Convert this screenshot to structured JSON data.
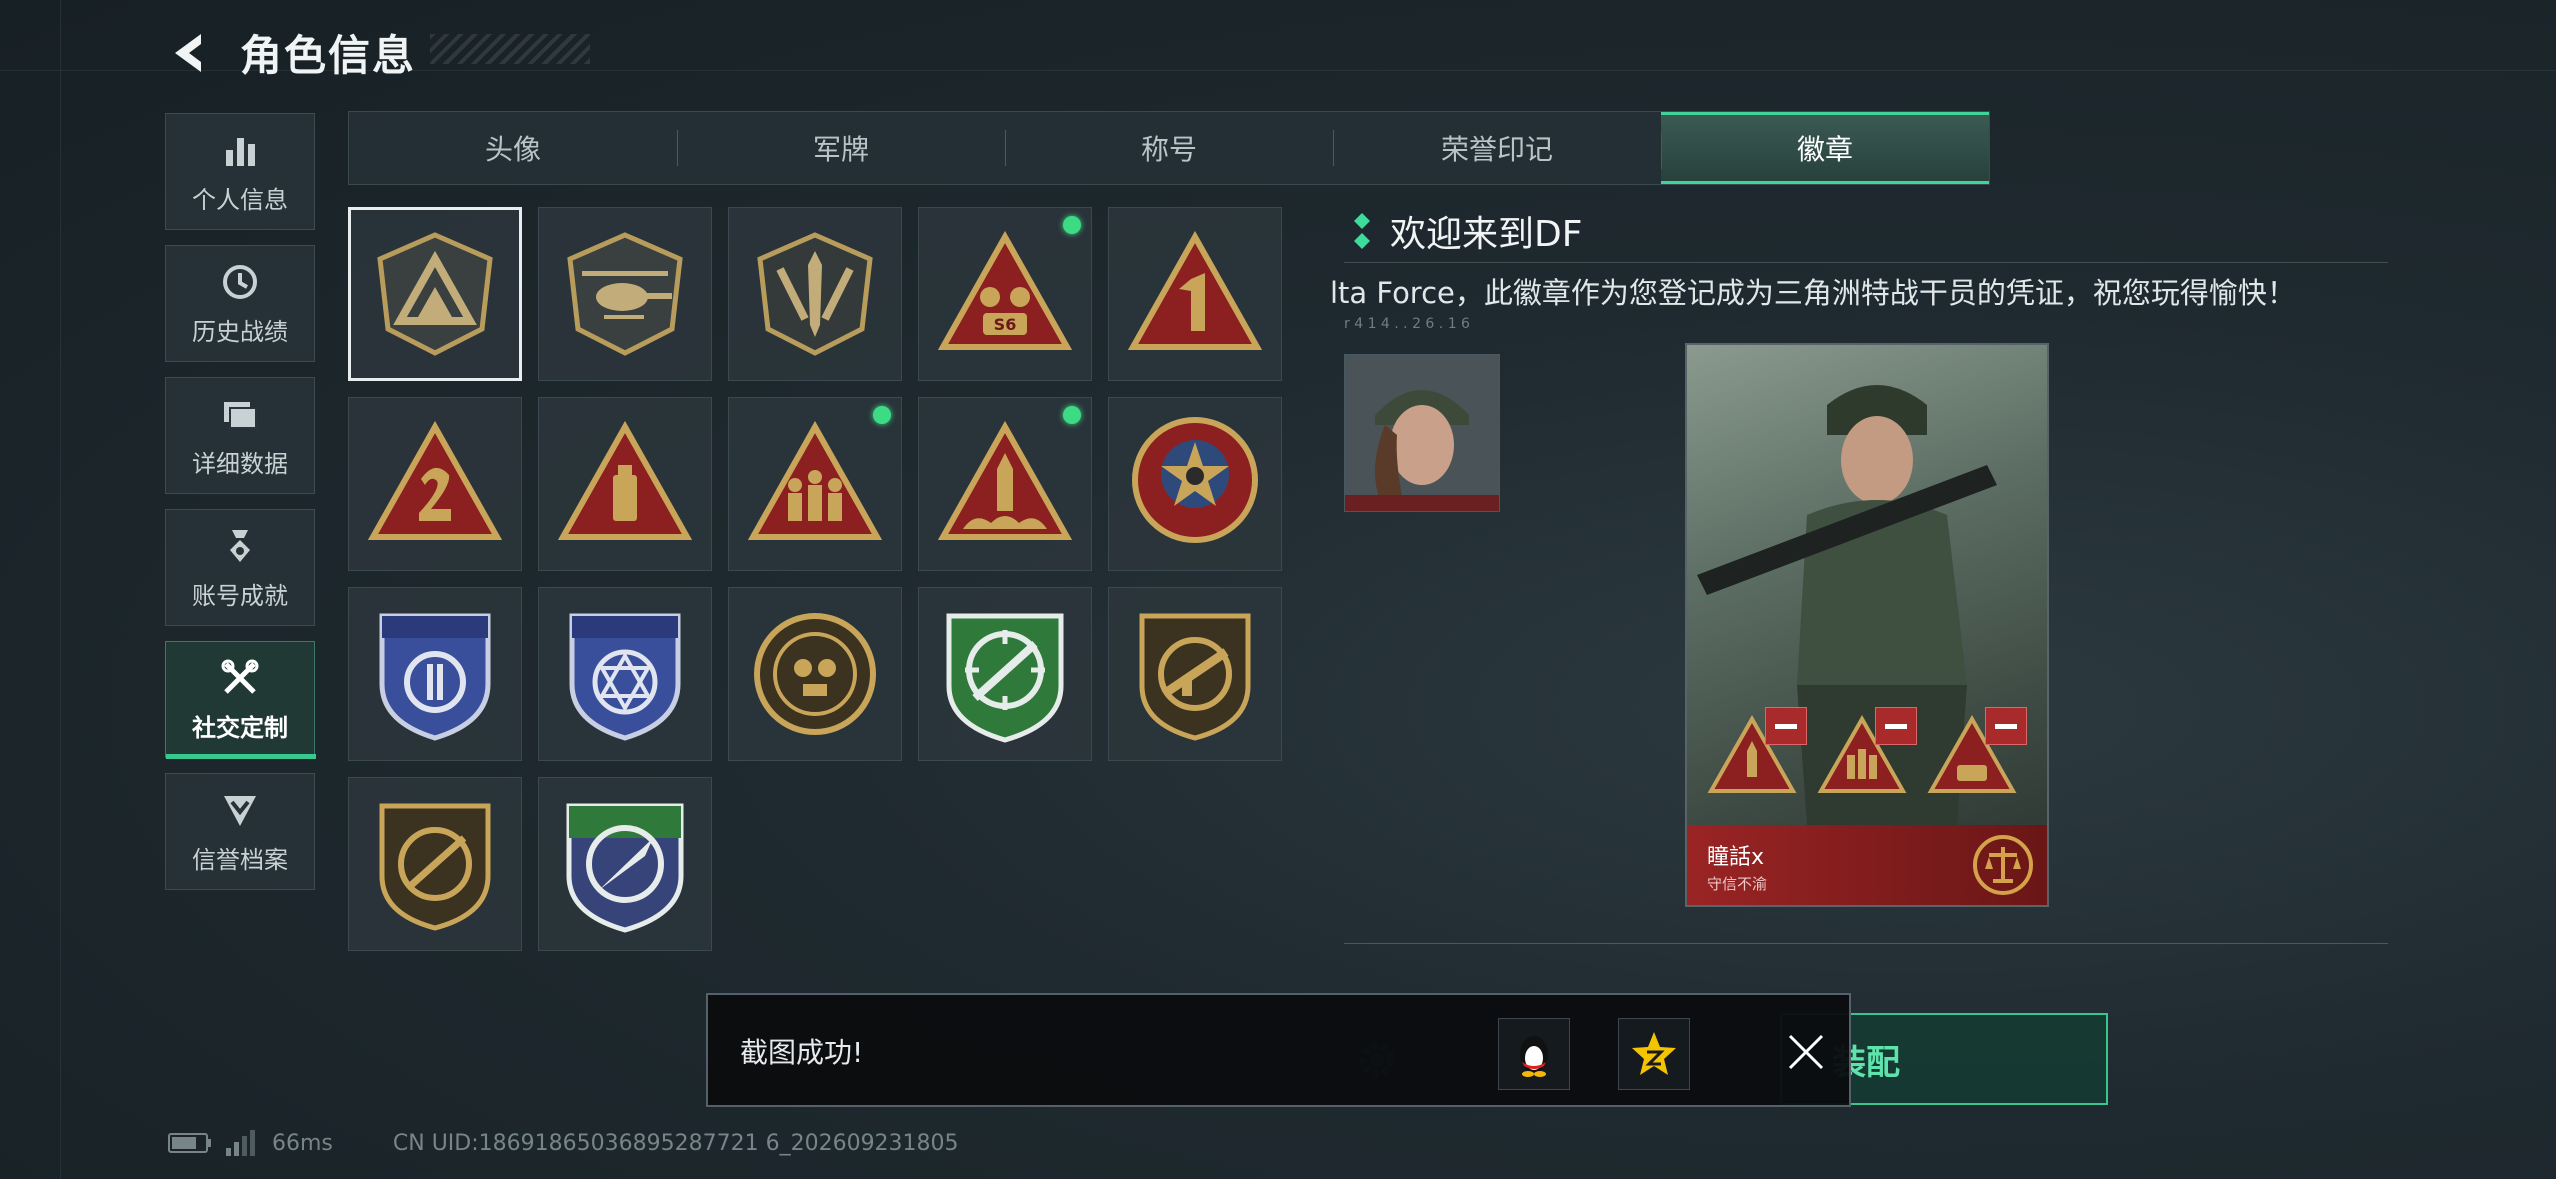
{
  "header": {
    "title": "角色信息"
  },
  "side_nav": [
    {
      "label": "个人信息",
      "icon": "bar-chart-icon",
      "active": false
    },
    {
      "label": "历史战绩",
      "icon": "history-clock-icon",
      "active": false
    },
    {
      "label": "详细数据",
      "icon": "folder-icon",
      "active": false
    },
    {
      "label": "账号成就",
      "icon": "medal-icon",
      "active": false
    },
    {
      "label": "社交定制",
      "icon": "tools-icon",
      "active": true
    },
    {
      "label": "信誉档案",
      "icon": "shield-chevron-icon",
      "active": false
    }
  ],
  "tabs": [
    {
      "label": "头像",
      "active": false
    },
    {
      "label": "军牌",
      "active": false
    },
    {
      "label": "称号",
      "active": false
    },
    {
      "label": "荣誉印记",
      "active": false
    },
    {
      "label": "徽章",
      "active": true
    }
  ],
  "badges": [
    {
      "icon": "delta-triangle-badge-icon",
      "selected": true,
      "new": false
    },
    {
      "icon": "helicopter-badge-icon",
      "selected": false,
      "new": false
    },
    {
      "icon": "dagger-shield-badge-icon",
      "selected": false,
      "new": false
    },
    {
      "icon": "s6-triangle-badge-icon",
      "selected": false,
      "new": true
    },
    {
      "icon": "number-1-triangle-badge-icon",
      "selected": false,
      "new": false
    },
    {
      "icon": "number-2-triangle-badge-icon",
      "selected": false,
      "new": false
    },
    {
      "icon": "usb-triangle-badge-icon",
      "selected": false,
      "new": false
    },
    {
      "icon": "soldiers-triangle-badge-icon",
      "selected": false,
      "new": true
    },
    {
      "icon": "rocket-triangle-badge-icon",
      "selected": false,
      "new": true
    },
    {
      "icon": "star-circle-badge-icon",
      "selected": false,
      "new": false
    },
    {
      "icon": "blue-emblem-shield-badge-icon",
      "selected": false,
      "new": false
    },
    {
      "icon": "blue-hexagram-shield-badge-icon",
      "selected": false,
      "new": false
    },
    {
      "icon": "round-skull-badge-icon",
      "selected": false,
      "new": false
    },
    {
      "icon": "green-rifle-shield-badge-icon",
      "selected": false,
      "new": false
    },
    {
      "icon": "smg-shield-badge-icon",
      "selected": false,
      "new": false
    },
    {
      "icon": "sniper-shield-badge-icon",
      "selected": false,
      "new": false
    },
    {
      "icon": "knife-shield-badge-icon",
      "selected": false,
      "new": false
    }
  ],
  "detail": {
    "title": "欢迎来到DF",
    "description": "lta Force，此徽章作为您登记成为三角洲特战干员的凭证，祝您玩得愉快！",
    "sub_text": "r 4 1 4 . . 2 6 . 1 6"
  },
  "preview": {
    "player_name": "瞳話x",
    "motto": "守信不渝",
    "slots": [
      "rocket-triangle-badge-icon",
      "soldiers-triangle-badge-icon",
      "s6-triangle-badge-icon"
    ]
  },
  "equip_button": {
    "label": "装配"
  },
  "toast": {
    "text": "截图成功!",
    "share_targets": [
      "qq-penguin-icon",
      "qzone-star-icon"
    ]
  },
  "status_bar": {
    "ping": "66ms",
    "uid": "CN UID:18691865036895287721 6_202609231805"
  },
  "colors": {
    "accent": "#37c98f",
    "new_dot": "#3ddc84",
    "footer_red": "#9a2424"
  }
}
